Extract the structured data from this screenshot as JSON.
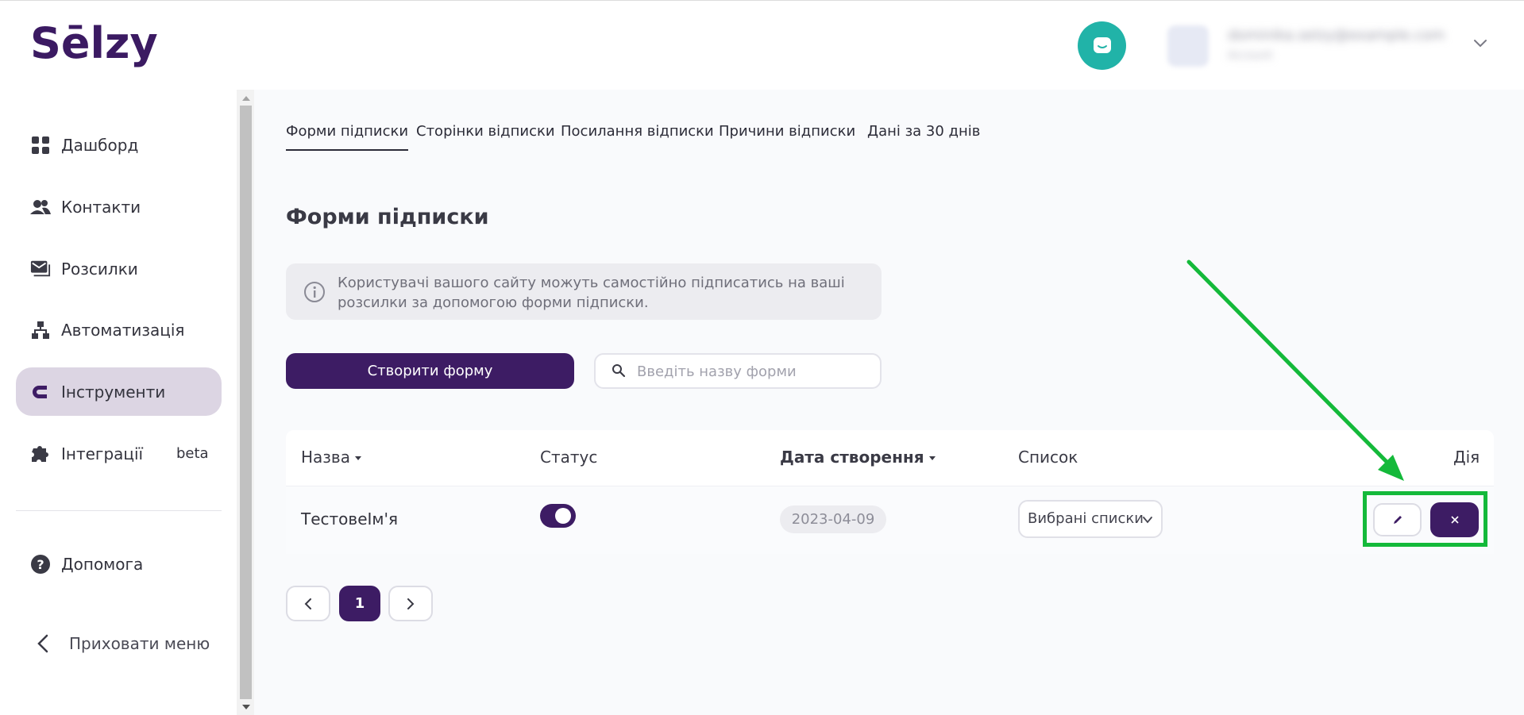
{
  "brand": {
    "logo_text": "Sēlzy",
    "accent": "#3d1c64",
    "highlight": "#14b93a"
  },
  "header": {
    "chat_icon": "chat-bubble-icon",
    "account_email": "dominika.selzy@example.com",
    "account_sub": "Account"
  },
  "sidebar": {
    "items": [
      {
        "label": "Дашборд",
        "icon": "dashboard-icon"
      },
      {
        "label": "Контакти",
        "icon": "contacts-icon"
      },
      {
        "label": "Розсилки",
        "icon": "mail-icon"
      },
      {
        "label": "Автоматизація",
        "icon": "automation-icon"
      },
      {
        "label": "Інструменти",
        "icon": "magnet-icon",
        "active": true
      },
      {
        "label": "Інтеграції",
        "icon": "puzzle-icon",
        "badge": "beta"
      }
    ],
    "help_label": "Допомога",
    "hide_menu_label": "Приховати меню"
  },
  "tabs": [
    {
      "label": "Форми підписки",
      "active": true
    },
    {
      "label": "Сторінки відписки"
    },
    {
      "label": "Посилання відписки"
    },
    {
      "label": "Причини відписки"
    },
    {
      "label": "Дані за 30 днів"
    }
  ],
  "page_title": "Форми підписки",
  "info_text": "Користувачі вашого сайту можуть самостійно підписатись на ваші розсилки за допомогою форми підписки.",
  "create_button_label": "Створити форму",
  "search": {
    "placeholder": "Введіть назву форми",
    "value": ""
  },
  "table": {
    "columns": [
      "Назва",
      "Статус",
      "Дата створення",
      "Список",
      "Дія"
    ],
    "rows": [
      {
        "name": "ТестовеІм'я",
        "status_on": true,
        "created": "2023-04-09",
        "list": "Вибрані списки"
      }
    ]
  },
  "pagination": {
    "current_page": "1"
  }
}
